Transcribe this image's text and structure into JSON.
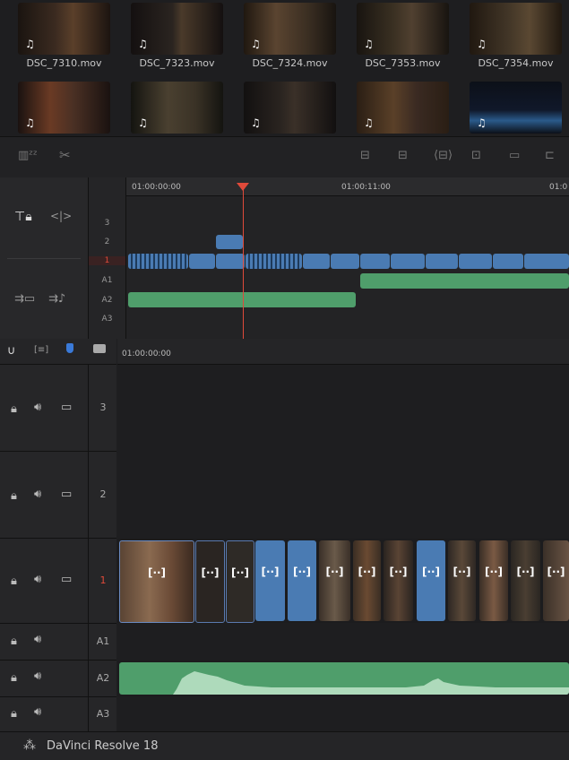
{
  "media_pool": {
    "clips": [
      {
        "name": "DSC_7310.mov",
        "color": "#3a2a20"
      },
      {
        "name": "DSC_7323.mov",
        "color": "#2a2420"
      },
      {
        "name": "DSC_7324.mov",
        "color": "#3a2e22"
      },
      {
        "name": "DSC_7353.mov",
        "color": "#2b2520"
      },
      {
        "name": "DSC_7354.mov",
        "color": "#3a3026"
      },
      {
        "name": "",
        "color": "#4a3024"
      },
      {
        "name": "",
        "color": "#3a3226"
      },
      {
        "name": "",
        "color": "#2a2420"
      },
      {
        "name": "",
        "color": "#3a2a22"
      },
      {
        "name": "",
        "color": "#182838"
      }
    ]
  },
  "upper_timeline": {
    "timecode_start": "01:00:00:00",
    "timecode_mid": "01:00:11:00",
    "timecode_end": "01:0",
    "tracks": [
      "3",
      "2",
      "1",
      "A1",
      "A2",
      "A3"
    ]
  },
  "lower_timeline": {
    "timecode_start": "01:00:00:00",
    "tracks": [
      {
        "label": "3"
      },
      {
        "label": "2"
      },
      {
        "label": "1"
      },
      {
        "label": "A1"
      },
      {
        "label": "A2"
      },
      {
        "label": "A3"
      }
    ],
    "bracket_icon": "[··]"
  },
  "status": {
    "app_name": "DaVinci Resolve 18"
  },
  "colors": {
    "video_clip": "#4a7bb3",
    "audio_clip": "#4f9e6b",
    "playhead": "#e04a3a",
    "active_track": "#e04a3a"
  }
}
